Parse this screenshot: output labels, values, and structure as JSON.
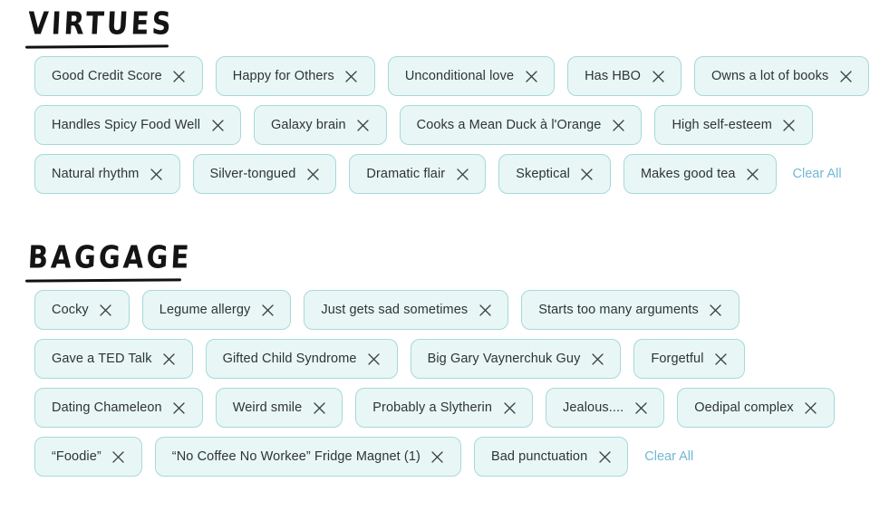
{
  "theme": {
    "background": "#ffffff",
    "chip_fill": "#e9f6f6",
    "chip_border": "#a6d9d9",
    "chip_text": "#2d3436",
    "link_color": "#72b8d6",
    "heading_color": "#141414",
    "close_icon_color": "#3b3f42"
  },
  "sections": [
    {
      "id": "virtues",
      "title": "VIRTUES",
      "clear_all_label": "Clear All",
      "rows": [
        [
          "Good Credit Score",
          "Happy for Others",
          "Unconditional love",
          "Has HBO",
          "Owns a lot of books"
        ],
        [
          "Handles Spicy Food Well",
          "Galaxy brain",
          "Cooks a Mean Duck à l'Orange",
          "High self-esteem"
        ],
        [
          "Natural rhythm",
          "Silver-tongued",
          "Dramatic flair",
          "Skeptical",
          "Makes good tea"
        ]
      ],
      "clear_all_row": 2
    },
    {
      "id": "baggage",
      "title": "BAGGAGE",
      "clear_all_label": "Clear All",
      "rows": [
        [
          "Cocky",
          "Legume allergy",
          "Just gets sad sometimes",
          "Starts too many arguments"
        ],
        [
          "Gave a TED Talk",
          "Gifted Child Syndrome",
          "Big Gary Vaynerchuk Guy",
          "Forgetful"
        ],
        [
          "Dating Chameleon",
          "Weird smile",
          "Probably a Slytherin",
          "Jealous....",
          "Oedipal complex"
        ],
        [
          "“Foodie”",
          "“No Coffee No Workee” Fridge Magnet (1)",
          "Bad punctuation"
        ]
      ],
      "clear_all_row": 3
    }
  ],
  "icons": {
    "close": "close-icon"
  }
}
